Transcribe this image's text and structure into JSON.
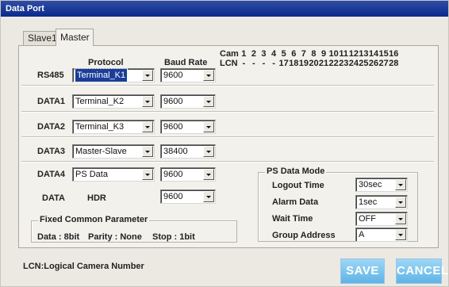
{
  "window": {
    "title": "Data Port"
  },
  "tabs": [
    {
      "label": "Slave1"
    },
    {
      "label": "Master"
    }
  ],
  "columns": {
    "protocol": "Protocol",
    "baud_rate": "Baud Rate"
  },
  "cam_table": {
    "cam_label": "Cam",
    "lcn_label": "LCN",
    "cams": [
      "1",
      "2",
      "3",
      "4",
      "5",
      "6",
      "7",
      "8",
      "9",
      "10",
      "11",
      "12",
      "13",
      "14",
      "15",
      "16"
    ],
    "lcns": [
      "-",
      "-",
      "-",
      "-",
      "17",
      "18",
      "19",
      "20",
      "21",
      "22",
      "23",
      "24",
      "25",
      "26",
      "27",
      "28"
    ]
  },
  "ports": [
    {
      "label": "RS485",
      "protocol": "Terminal_K1",
      "baud": "9600",
      "protocol_selected": true
    },
    {
      "label": "DATA1",
      "protocol": "Terminal_K2",
      "baud": "9600"
    },
    {
      "label": "DATA2",
      "protocol": "Terminal_K3",
      "baud": "9600"
    },
    {
      "label": "DATA3",
      "protocol": "Master-Slave",
      "baud": "38400"
    },
    {
      "label": "DATA4",
      "protocol": "PS Data",
      "baud": "9600"
    }
  ],
  "data_hdr": {
    "label": "DATA",
    "protocol_text": "HDR",
    "baud": "9600"
  },
  "fixed_param": {
    "title": "Fixed Common Parameter",
    "data": "Data : 8bit",
    "parity": "Parity : None",
    "stop": "Stop : 1bit"
  },
  "ps_mode": {
    "title": "PS Data Mode",
    "items": [
      {
        "label": "Logout Time",
        "value": "30sec"
      },
      {
        "label": "Alarm Data",
        "value": "1sec"
      },
      {
        "label": "Wait Time",
        "value": "OFF"
      },
      {
        "label": "Group Address",
        "value": "A"
      }
    ]
  },
  "footer": {
    "note": "LCN:Logical Camera Number"
  },
  "buttons": {
    "save": "SAVE",
    "cancel": "CANCEL"
  }
}
